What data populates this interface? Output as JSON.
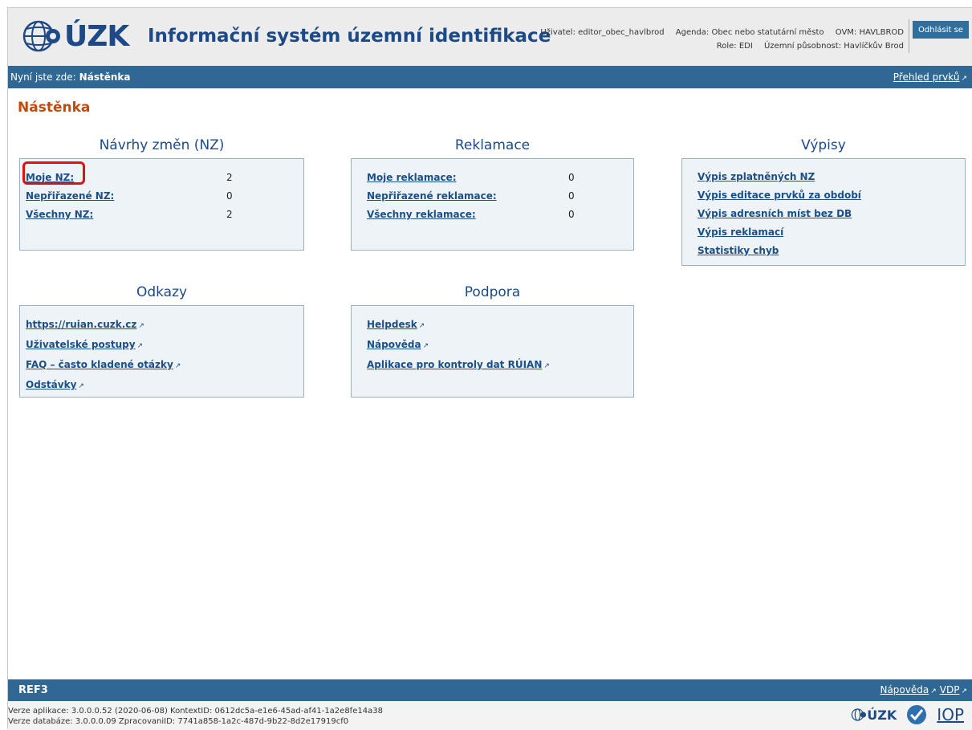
{
  "header": {
    "logo_text": "ÚZK",
    "app_title": "Informační systém územní identifikace",
    "user": "Uživatel: editor_obec_havlbrod",
    "agenda": "Agenda: Obec nebo statutární město",
    "ovm": "OVM: HAVLBROD",
    "role": "Role: EDI",
    "territory": "Územní působnost: Havlíčkův Brod",
    "logout_label": "Odhlásit se"
  },
  "breadcrumb": {
    "prefix": "Nyní jste zde:",
    "current": "Nástěnka",
    "overview_link": "Přehled prvků"
  },
  "page_title": "Nástěnka",
  "sections": {
    "nz": {
      "title": "Návrhy změn (NZ)",
      "items": [
        {
          "label": "Moje NZ:",
          "value": "2"
        },
        {
          "label": "Nepřiřazené NZ:",
          "value": "0"
        },
        {
          "label": "Všechny NZ:",
          "value": "2"
        }
      ]
    },
    "reklamace": {
      "title": "Reklamace",
      "items": [
        {
          "label": "Moje reklamace:",
          "value": "0"
        },
        {
          "label": "Nepřiřazené reklamace:",
          "value": "0"
        },
        {
          "label": "Všechny reklamace:",
          "value": "0"
        }
      ]
    },
    "vypisy": {
      "title": "Výpisy",
      "links": [
        "Výpis zplatněných NZ",
        "Výpis editace prvků za období",
        "Výpis adresních míst bez DB",
        "Výpis reklamací",
        "Statistiky chyb"
      ]
    },
    "odkazy": {
      "title": "Odkazy",
      "links": [
        "https://ruian.cuzk.cz",
        "Uživatelské postupy",
        "FAQ – často kladené otázky",
        "Odstávky"
      ]
    },
    "podpora": {
      "title": "Podpora",
      "links": [
        "Helpdesk",
        "Nápověda",
        "Aplikace pro kontroly dat RÚIAN"
      ]
    }
  },
  "footer": {
    "env": "REF3",
    "help_link": "Nápověda",
    "vdp_link": "VDP",
    "version_app": "Verze aplikace: 3.0.0.0.52 (2020-06-08) KontextID: 0612dc5a-e1e6-45ad-af41-1a2e8fe14a38",
    "version_db": "Verze databáze: 3.0.0.0.09 ZpracovaniID: 7741a858-1a2c-487d-9b22-8d2e17919cf0",
    "logo_cuzk": "ÚZK",
    "logo_iop": "IOP"
  },
  "colors": {
    "brand_blue": "#2f6893",
    "title_orange": "#c4490a",
    "highlight_red": "#e21010"
  },
  "icons": {
    "external_link": "external-link-icon",
    "logo": "cuzk-logo-icon"
  }
}
